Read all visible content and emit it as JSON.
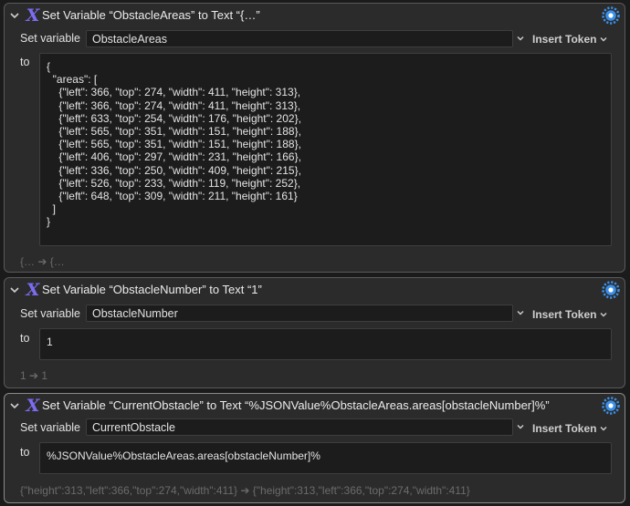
{
  "actions": [
    {
      "title": "Set Variable “ObstacleAreas” to Text “{…”",
      "set_variable_label": "Set variable",
      "variable_name": "ObstacleAreas",
      "insert_token_label": "Insert Token",
      "to_label": "to",
      "text_lines": [
        "{",
        "  \"areas\": [",
        "    {\"left\": 366, \"top\": 274, \"width\": 411, \"height\": 313},",
        "    {\"left\": 366, \"top\": 274, \"width\": 411, \"height\": 313},",
        "    {\"left\": 633, \"top\": 254, \"width\": 176, \"height\": 202},",
        "    {\"left\": 565, \"top\": 351, \"width\": 151, \"height\": 188},",
        "    {\"left\": 565, \"top\": 351, \"width\": 151, \"height\": 188},",
        "    {\"left\": 406, \"top\": 297, \"width\": 231, \"height\": 166},",
        "    {\"left\": 336, \"top\": 250, \"width\": 409, \"height\": 215},",
        "    {\"left\": 526, \"top\": 233, \"width\": 119, \"height\": 252},",
        "    {\"left\": 648, \"top\": 309, \"width\": 211, \"height\": 161}",
        "  ]",
        "}"
      ],
      "result": "{… ➔ {…"
    },
    {
      "title": "Set Variable “ObstacleNumber” to Text “1”",
      "set_variable_label": "Set variable",
      "variable_name": "ObstacleNumber",
      "insert_token_label": "Insert Token",
      "to_label": "to",
      "text_lines": [
        "1"
      ],
      "result": "1 ➔ 1"
    },
    {
      "title": "Set Variable “CurrentObstacle” to Text “%JSONValue%ObstacleAreas.areas[obstacleNumber]%”",
      "set_variable_label": "Set variable",
      "variable_name": "CurrentObstacle",
      "insert_token_label": "Insert Token",
      "to_label": "to",
      "text_lines": [
        "%JSONValue%ObstacleAreas.areas[obstacleNumber]%"
      ],
      "result": "{\"height\":313,\"left\":366,\"top\":274,\"width\":411} ➔ {\"height\":313,\"left\":366,\"top\":274,\"width\":411}"
    }
  ],
  "icons": {
    "collapse": "chevron-down-icon",
    "action": "variable-x-icon",
    "gear": "gear-icon",
    "dropdown": "chevron-down-icon"
  },
  "colors": {
    "panel": "#2b2b2b",
    "field": "#1c1c1c",
    "x_icon_purple": "#7b6cf0",
    "gear_blue": "#3b8fe6",
    "muted_text": "#6b6b6b"
  }
}
